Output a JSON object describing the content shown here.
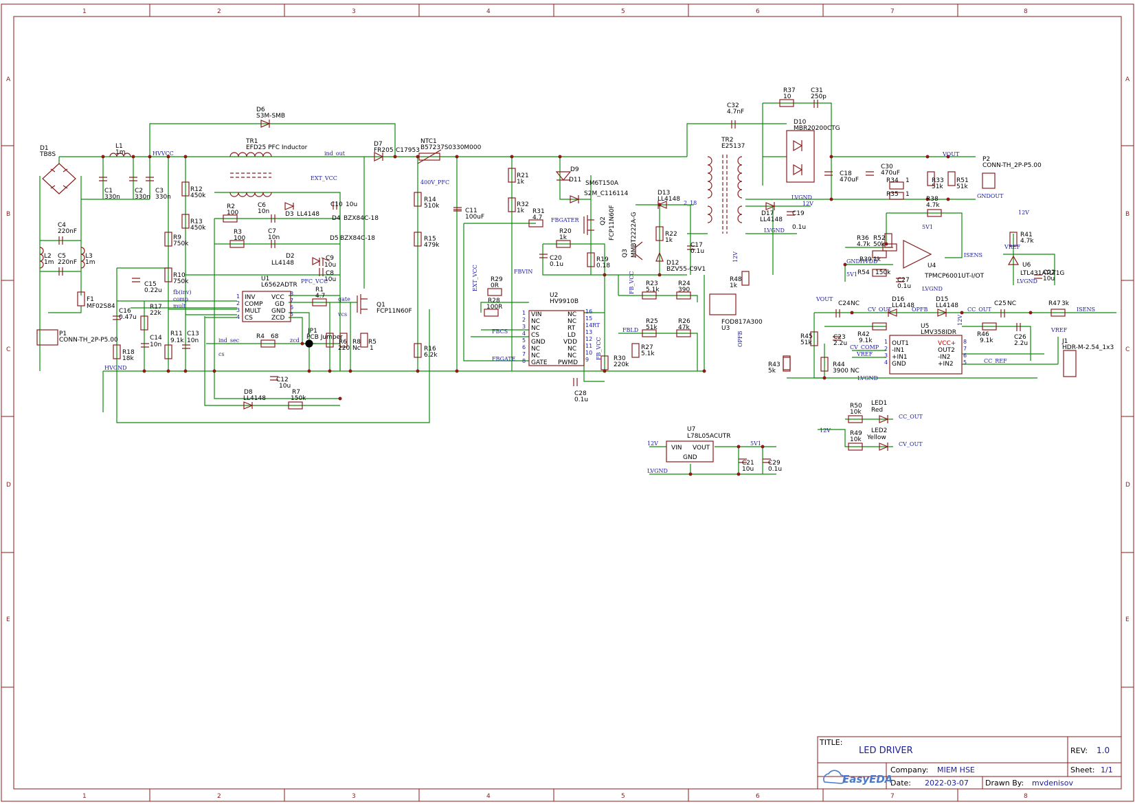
{
  "grid": {
    "cols": [
      "1",
      "2",
      "3",
      "4",
      "5",
      "6",
      "7",
      "8"
    ],
    "rows": [
      "A",
      "B",
      "C",
      "D",
      "E"
    ]
  },
  "components": {
    "D1": [
      "D1",
      "TB8S"
    ],
    "L1": [
      "L1",
      "1m"
    ],
    "C1": [
      "C1",
      "330n"
    ],
    "C2": [
      "C2",
      "330n"
    ],
    "C3": [
      "C3",
      "330n"
    ],
    "C4": [
      "C4",
      "220nF"
    ],
    "C5": [
      "C5",
      "220nF"
    ],
    "L2": [
      "L2",
      "1m"
    ],
    "L3": [
      "L3",
      "1m"
    ],
    "F1": [
      "F1",
      "MF02S84"
    ],
    "P1": [
      "P1",
      "CONN-TH_2P-P5.00"
    ],
    "D6": [
      "D6",
      "S3M-SMB"
    ],
    "TR1": [
      "TR1",
      "EFD25 PFC Inductor"
    ],
    "D7": [
      "D7",
      "FR205"
    ],
    "NTC1": [
      "NTC1",
      "B57237S0330M000"
    ],
    "C17953": [
      "C17953",
      ""
    ],
    "R12": [
      "R12",
      "450k"
    ],
    "R13": [
      "R13",
      "450k"
    ],
    "R9": [
      "R9",
      "750k"
    ],
    "R10": [
      "R10",
      "750k"
    ],
    "R2": [
      "R2",
      "100"
    ],
    "C6": [
      "C6",
      "10n"
    ],
    "D3": [
      "D3",
      "LL4148"
    ],
    "C10": [
      "C10",
      "10u"
    ],
    "D4": [
      "D4",
      "BZX84C-18"
    ],
    "R3": [
      "R3",
      "100"
    ],
    "C7": [
      "C7",
      "10n"
    ],
    "D5": [
      "D5",
      "BZX84C-18"
    ],
    "D2": [
      "D2",
      "LL4148"
    ],
    "C9": [
      "C9",
      "10u"
    ],
    "C8": [
      "C8",
      "10u"
    ],
    "U1": [
      "U1",
      "L6562ADTR"
    ],
    "R1": [
      "R1",
      "4.7"
    ],
    "Q1": [
      "Q1",
      "FCP11N60F"
    ],
    "C15": [
      "C15",
      "0.22u"
    ],
    "C16": [
      "C16",
      "0.47u"
    ],
    "R18": [
      "R18",
      "18k"
    ],
    "R17": [
      "R17",
      "22k"
    ],
    "C14": [
      "C14",
      "10n"
    ],
    "R11": [
      "R11",
      "9.1k"
    ],
    "C13": [
      "C13",
      "10n"
    ],
    "R4": [
      "R4",
      "68"
    ],
    "JP1": [
      "JP1",
      "PCB Jumper"
    ],
    "R6": [
      "R6",
      "220"
    ],
    "R8": [
      "R8",
      "Nc"
    ],
    "R5": [
      "R5",
      "1"
    ],
    "C12": [
      "C12",
      "10u"
    ],
    "D8": [
      "D8",
      "LL4148"
    ],
    "R7": [
      "R7",
      "150k"
    ],
    "R14": [
      "R14",
      "510k"
    ],
    "R15": [
      "R15",
      "479k"
    ],
    "R16": [
      "R16",
      "6.2k"
    ],
    "C11": [
      "C11",
      "100uF"
    ],
    "R21": [
      "R21",
      "1k"
    ],
    "R32": [
      "R32",
      "1k"
    ],
    "D9": [
      "D9",
      ""
    ],
    "D11": [
      "D11",
      "SM6T150A"
    ],
    "S2M": [
      "S2M_C116114",
      ""
    ],
    "R31": [
      "R31",
      "4.7"
    ],
    "Q2": [
      "Q2",
      "FCP11N60F"
    ],
    "R20": [
      "R20",
      "1k"
    ],
    "C20": [
      "C20",
      "0.1u"
    ],
    "R19": [
      "R19",
      "0.18"
    ],
    "R29": [
      "R29",
      "0R"
    ],
    "R28": [
      "R28",
      "100R"
    ],
    "U2": [
      "U2",
      "HV9910B"
    ],
    "C28": [
      "C28",
      "0.1u"
    ],
    "R30": [
      "R30",
      "220k"
    ],
    "Q3": [
      "Q3",
      "MMBT2222A-G"
    ],
    "D13": [
      "D13",
      "LL4148"
    ],
    "R22": [
      "R22",
      "1k"
    ],
    "D12": [
      "D12",
      "BZV55-C9V1"
    ],
    "C17": [
      "C17",
      "0.1u"
    ],
    "R23": [
      "R23",
      "5.1k"
    ],
    "R24": [
      "R24",
      "390"
    ],
    "R25": [
      "R25",
      "51k"
    ],
    "R26": [
      "R26",
      "47k"
    ],
    "R27": [
      "R27",
      "5.1k"
    ],
    "C32": [
      "C32",
      "4.7nF"
    ],
    "TR2": [
      "TR2",
      "E25137"
    ],
    "D17": [
      "D17",
      "LL4148"
    ],
    "C19": [
      "C19",
      "0.1u"
    ],
    "R48": [
      "R48",
      "1k"
    ],
    "U3": [
      "U3",
      "FOD817A300"
    ],
    "R37": [
      "R37",
      "10"
    ],
    "C31": [
      "C31",
      "250p"
    ],
    "D10": [
      "D10",
      "MBR20200CTG"
    ],
    "C18": [
      "C18",
      "470uF"
    ],
    "C30": [
      "C30",
      "470uF"
    ],
    "R34": [
      "R34",
      "1"
    ],
    "R35": [
      "R35",
      "1"
    ],
    "R33": [
      "R33",
      "51k"
    ],
    "R51": [
      "R51",
      "51k"
    ],
    "P2": [
      "P2",
      "CONN-TH_2P-P5.00"
    ],
    "R38": [
      "R38",
      "4.7k"
    ],
    "R36": [
      "R36",
      "4.7k"
    ],
    "R52": [
      "R52",
      "50k"
    ],
    "R39": [
      "R39",
      "1k"
    ],
    "R54": [
      "R54",
      "150k"
    ],
    "C27": [
      "C27",
      "0.1u"
    ],
    "U4": [
      "U4",
      "TPMCP6001UT-I/OT"
    ],
    "R41": [
      "R41",
      "4.7k"
    ],
    "U6": [
      "U6",
      "LTL431ATLT1G"
    ],
    "C22": [
      "C22",
      "10u"
    ],
    "C24": [
      "C24",
      "NC"
    ],
    "D16": [
      "D16",
      "LL4148"
    ],
    "D15": [
      "D15",
      "LL4148"
    ],
    "C25": [
      "C25",
      "NC"
    ],
    "R47": [
      "R47",
      "3k"
    ],
    "R45": [
      "R45",
      "51k"
    ],
    "C23": [
      "C23",
      "2.2u"
    ],
    "R42": [
      "R42",
      "9.1k"
    ],
    "U5": [
      "U5",
      "LMV358IDR"
    ],
    "R46": [
      "R46",
      "9.1k"
    ],
    "C26": [
      "C26",
      "2.2u"
    ],
    "J1": [
      "J1",
      "HDR-M-2.54_1x3"
    ],
    "R43": [
      "R43",
      "5k"
    ],
    "R44": [
      "R44",
      "3900 NC"
    ],
    "R50": [
      "R50",
      "10k"
    ],
    "LED1": [
      "LED1",
      "Red"
    ],
    "R49": [
      "R49",
      "10k"
    ],
    "LED2": [
      "LED2",
      "Yellow"
    ],
    "U7": [
      "U7",
      "L78L05ACUTR"
    ],
    "C21": [
      "C21",
      "10u"
    ],
    "C29": [
      "C29",
      "0.1u"
    ]
  },
  "nets": {
    "hvvcc": "HVVCC",
    "hvgnd": "HVGND",
    "ind_out": "ind_out",
    "ext_vcc": "EXT_VCC",
    "pfc_vcc": "PFC_VCC",
    "fb_inv": "fb(inv)",
    "comp": "comp",
    "mult": "mult",
    "gate": "gate",
    "vcs": "vcs",
    "ind_sec": "ind_sec",
    "zcd": "zcd",
    "cs": "cs",
    "v400": "400V_PFC",
    "fbgater": "FBGATER",
    "fbvin": "FBVIN",
    "fbcs": "FBCS",
    "fbgate": "FBGATE",
    "ext_vcc2": "EXT_VCC",
    "fb_vcc": "FB_VCC",
    "rt": "RT",
    "fbld": "FBLD",
    "fb_vcc2": "FB_VCC",
    "lvgnd": "LVGND",
    "v12": "12V",
    "vout": "VOUT",
    "gndout": "GNDOUT",
    "v5": "5V1",
    "isens": "ISENS",
    "gndhvdd": "GNDHVDD",
    "vref": "VREF",
    "cv_out": "CV_OUT",
    "cc_out": "CC_OUT",
    "opfb": "OPFB",
    "cv_comp": "CV_COMP",
    "cc_ref": "CC_REF",
    "v2_18": "2_18"
  },
  "u1_pins": {
    "left": [
      "INV",
      "COMP",
      "MULT",
      "CS"
    ],
    "left_num": [
      "1",
      "2",
      "3",
      "4"
    ],
    "right": [
      "VCC",
      "GD",
      "GND",
      "ZCD"
    ],
    "right_num": [
      "8",
      "7",
      "6",
      "5"
    ]
  },
  "u2_pins": {
    "left": [
      "VIN",
      "NC",
      "NC",
      "CS",
      "GND",
      "NC",
      "NC",
      "GATE"
    ],
    "left_num": [
      "1",
      "2",
      "3",
      "4",
      "5",
      "6",
      "7",
      "8"
    ],
    "right": [
      "NC",
      "NC",
      "RT",
      "LD",
      "VDD",
      "NC",
      "NC",
      "PWMD"
    ],
    "right_num": [
      "16",
      "15",
      "14",
      "13",
      "12",
      "11",
      "10",
      "9"
    ]
  },
  "u5_pins": {
    "left": [
      "OUT1",
      "-IN1",
      "+IN1",
      "GND"
    ],
    "left_num": [
      "1",
      "2",
      "3",
      "4"
    ],
    "right": [
      "VCC+",
      "OUT2",
      "-IN2",
      "+IN2"
    ],
    "right_num": [
      "8",
      "7",
      "6",
      "5"
    ]
  },
  "u7_pins": {
    "vin": "VIN",
    "vout": "VOUT",
    "gnd": "GND"
  },
  "title_block": {
    "title_label": "TITLE:",
    "title": "LED DRIVER",
    "rev_label": "REV:",
    "rev": "1.0",
    "company_label": "Company:",
    "company": "MIEM HSE",
    "sheet_label": "Sheet:",
    "sheet": "1/1",
    "date_label": "Date:",
    "date": "2022-03-07",
    "drawn_label": "Drawn By:",
    "drawn": "mvdenisov",
    "logo": "EasyEDA"
  },
  "colors": {
    "wire": "#0a8a0a",
    "component": "#8b1a1a",
    "net": "#1a1aa0",
    "frame": "#8b1a1a"
  }
}
